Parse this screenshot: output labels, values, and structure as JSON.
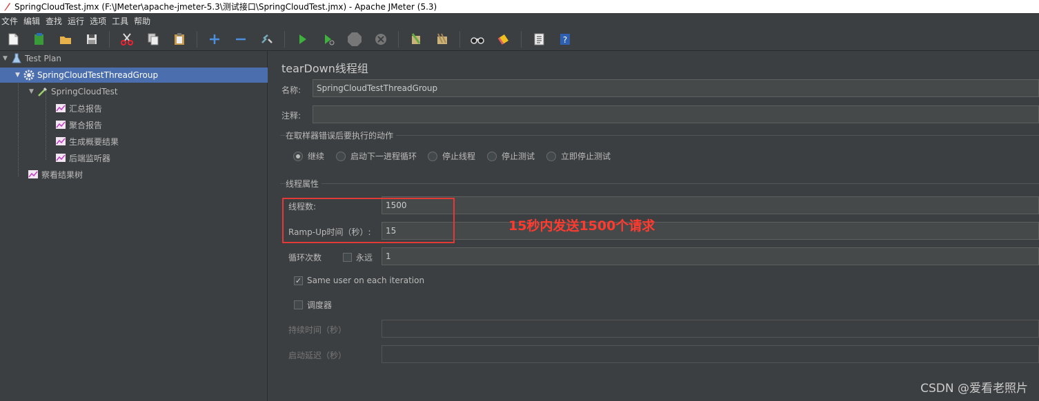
{
  "window": {
    "title": "SpringCloudTest.jmx (F:\\JMeter\\apache-jmeter-5.3\\测试接口\\SpringCloudTest.jmx) - Apache JMeter (5.3)"
  },
  "menu": [
    "文件",
    "编辑",
    "查找",
    "运行",
    "选项",
    "工具",
    "帮助"
  ],
  "toolbar_icons": [
    "new-icon",
    "templates-icon",
    "open-icon",
    "save-icon",
    "cut-icon",
    "copy-icon",
    "paste-icon",
    "expand-icon",
    "collapse-icon",
    "toggle-icon",
    "start-icon",
    "start-no-pause-icon",
    "stop-icon",
    "shutdown-icon",
    "clear-icon",
    "clear-all-icon",
    "search-icon",
    "reset-search-icon",
    "function-helper-icon",
    "help-icon"
  ],
  "tree": {
    "test_plan": "Test Plan",
    "thread_group": "SpringCloudTestThreadGroup",
    "sampler": "SpringCloudTest",
    "listeners": [
      "汇总报告",
      "聚合报告",
      "生成概要结果",
      "后端监听器"
    ],
    "result_tree": "察看结果树"
  },
  "panel": {
    "title": "tearDown线程组",
    "name_label": "名称:",
    "name_value": "SpringCloudTestThreadGroup",
    "comment_label": "注释:",
    "comment_value": "",
    "error_action_group": "在取样器错误后要执行的动作",
    "error_actions": [
      "继续",
      "启动下一进程循环",
      "停止线程",
      "停止测试",
      "立即停止测试"
    ],
    "selected_error_action": "继续",
    "thread_props_group": "线程属性",
    "threads_label": "线程数:",
    "threads_value": "1500",
    "rampup_label": "Ramp-Up时间（秒）:",
    "rampup_value": "15",
    "loop_label": "循环次数",
    "forever_label": "永远",
    "forever_checked": false,
    "loop_value": "1",
    "same_user_label": "Same user on each iteration",
    "same_user_checked": true,
    "scheduler_label": "调度器",
    "scheduler_checked": false,
    "duration_label": "持续时间（秒）",
    "duration_value": "",
    "delay_label": "启动延迟（秒）",
    "delay_value": ""
  },
  "annotation": "15秒内发送1500个请求",
  "watermark": "CSDN @爱看老照片",
  "colors": {
    "background": "#3c3f41",
    "selection": "#4b6eaf",
    "annotation": "#ff3b30",
    "field": "#45494a"
  }
}
